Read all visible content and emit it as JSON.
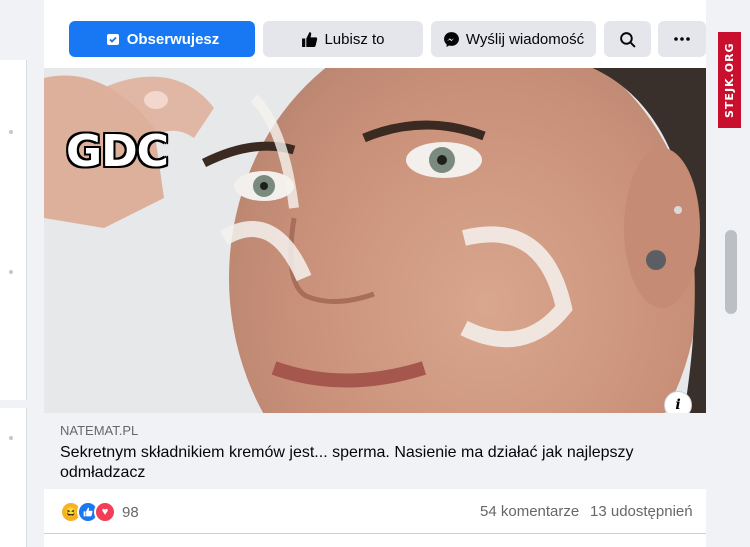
{
  "header": {
    "follow_label": "Obserwujesz",
    "like_label": "Lubisz to",
    "message_label": "Wyślij wiadomość"
  },
  "post": {
    "overlay_text": "GDC",
    "link_domain": "NATEMAT.PL",
    "link_title": "Sekretnym składnikiem kremów jest... sperma. Nasienie ma działać jak najlepszy odmładzacz",
    "reaction_count": "98",
    "comments": "54 komentarze",
    "shares": "13 udostępnień",
    "info_label": "i"
  },
  "watermark": "STEJK.ORG",
  "colors": {
    "accent": "#1877f2",
    "button_gray": "#e4e6eb",
    "watermark_red": "#c8102e"
  }
}
